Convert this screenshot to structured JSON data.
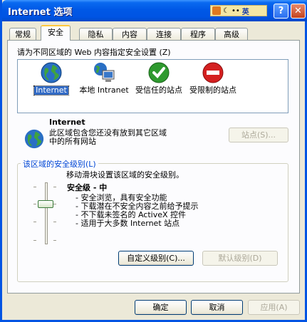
{
  "window": {
    "title": "Internet 选项"
  },
  "ime": {
    "mode_label": "英"
  },
  "title_buttons": {
    "help": "?",
    "close": "✕"
  },
  "tabs": [
    {
      "label": "常规"
    },
    {
      "label": "安全"
    },
    {
      "label": "隐私"
    },
    {
      "label": "内容"
    },
    {
      "label": "连接"
    },
    {
      "label": "程序"
    },
    {
      "label": "高级"
    }
  ],
  "active_tab": "安全",
  "zone_prompt": "请为不同区域的 Web 内容指定安全设置 (Z)",
  "zones": [
    {
      "label": "Internet",
      "icon": "globe-icon",
      "selected": true
    },
    {
      "label": "本地 Intranet",
      "icon": "intranet-icon",
      "selected": false
    },
    {
      "label": "受信任的站点",
      "icon": "check-icon",
      "selected": false
    },
    {
      "label": "受限制的站点",
      "icon": "restricted-icon",
      "selected": false
    }
  ],
  "zone_info": {
    "name": "Internet",
    "description_line1": "此区域包含您还没有放到其它区域",
    "description_line2": "中的所有网站",
    "sites_button": "站点(S)..."
  },
  "security_level": {
    "group_label": "该区域的安全级别(L)",
    "hint": "移动滑块设置该区域的安全级别。",
    "level_title": "安全级 - 中",
    "bullets": [
      "- 安全浏览，具有安全功能",
      "- 下载潜在不安全内容之前给予提示",
      "- 不下载未签名的 ActiveX 控件",
      "- 适用于大多数 Internet 站点"
    ],
    "slider_position": "中",
    "custom_button": "自定义级别(C)...",
    "default_button": "默认级别(D)"
  },
  "footer": {
    "ok": "确定",
    "cancel": "取消",
    "apply": "应用(A)"
  },
  "colors": {
    "titlebar": "#0054e3",
    "face": "#ece9d8",
    "panel": "#fcfcfe",
    "selection": "#316ac5",
    "group_label": "#0046d5"
  }
}
